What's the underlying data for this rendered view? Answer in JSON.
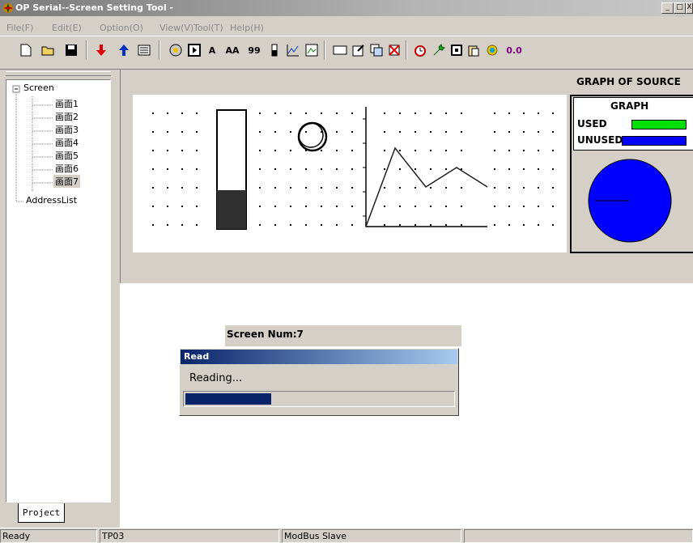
{
  "window": {
    "title": "OP Serial--Screen Setting Tool -",
    "minimize": "_",
    "maximize": "□",
    "close": "X"
  },
  "menu": [
    {
      "label": "File(F)",
      "name": "menu-file"
    },
    {
      "label": "Edit(E)",
      "name": "menu-edit"
    },
    {
      "label": "Option(O)",
      "name": "menu-option"
    },
    {
      "label": "View(V)",
      "name": "menu-view"
    },
    {
      "label": "Tool(T)",
      "name": "menu-tool"
    },
    {
      "label": "Help(H)",
      "name": "menu-help"
    }
  ],
  "toolbar": {
    "text_a": "A",
    "text_aa": "AA",
    "text_99": "99",
    "value_readout": "0.0"
  },
  "tree": {
    "root": "Screen",
    "screens": [
      "画面1",
      "画面2",
      "画面3",
      "画面4",
      "画面5",
      "画面6",
      "画面7"
    ],
    "selected": "画面7",
    "address_list": "AddressList",
    "expander": "−"
  },
  "project_tab": "Project",
  "graph": {
    "heading": "GRAPH OF SOURCE",
    "box_title": "GRAPH",
    "used_label": "USED",
    "unused_label": "UNUSED",
    "used_color": "#00e000",
    "unused_color": "#0000ff"
  },
  "screen_num": "Screen Num:7",
  "read_dialog": {
    "title": "Read",
    "message": "Reading...",
    "progress": 0.32
  },
  "status": {
    "ready": "Ready",
    "device": "TP03",
    "protocol": "ModBus Slave"
  },
  "colors": {
    "face": "#d4d0c8",
    "titlebar_inactive": "#808080",
    "dialog_title": "#0a246a",
    "pie_fill": "#0000ff"
  }
}
